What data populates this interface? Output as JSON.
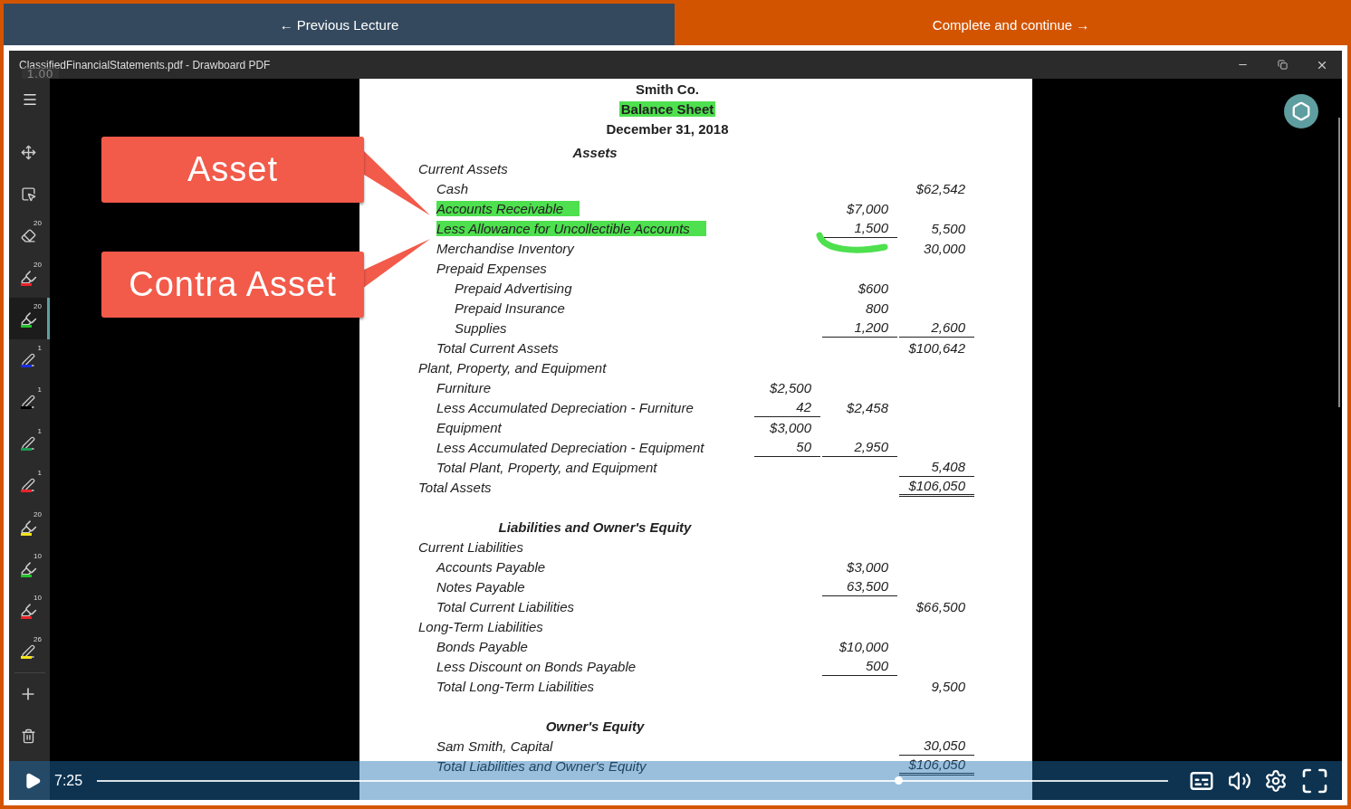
{
  "nav": {
    "previous": {
      "label": "Previous Lecture",
      "icon": "←"
    },
    "complete": {
      "label": "Complete and continue",
      "icon": "→"
    }
  },
  "window": {
    "title": "ClassifiedFinancialStatements.pdf - Drawboard PDF",
    "zoom_label": "1.00"
  },
  "tools": [
    {
      "kind": "move",
      "selected": false
    },
    {
      "kind": "select",
      "selected": false
    },
    {
      "kind": "eraser",
      "badge": "20",
      "selected": false
    },
    {
      "kind": "marker",
      "badge": "20",
      "color": "#e8232a",
      "selected": false
    },
    {
      "kind": "marker",
      "badge": "20",
      "color": "#22c02a",
      "selected": true
    },
    {
      "kind": "pen",
      "badge": "1",
      "color": "#1a2ee0",
      "selected": false
    },
    {
      "kind": "pen",
      "badge": "1",
      "color": "#000000",
      "selected": false
    },
    {
      "kind": "pen",
      "badge": "1",
      "color": "#1d9a55",
      "selected": false
    },
    {
      "kind": "pen",
      "badge": "1",
      "color": "#e8232a",
      "selected": false
    },
    {
      "kind": "marker",
      "badge": "20",
      "color": "#f2e21b",
      "selected": false
    },
    {
      "kind": "marker",
      "badge": "10",
      "color": "#22c02a",
      "selected": false
    },
    {
      "kind": "marker",
      "badge": "10",
      "color": "#e8232a",
      "selected": false
    },
    {
      "kind": "pen",
      "badge": "26",
      "color": "#f2e21b",
      "selected": false
    }
  ],
  "callouts": [
    {
      "text": "Asset"
    },
    {
      "text": "Contra Asset"
    }
  ],
  "document": {
    "titles": [
      {
        "text": "Smith Co.",
        "highlighted": false
      },
      {
        "text": "Balance Sheet",
        "highlighted": true
      },
      {
        "text": "December 31, 2018",
        "highlighted": false
      }
    ],
    "sections": [
      {
        "kind": "grouped",
        "heading": "Assets",
        "children": [
          {
            "text": "Current Assets",
            "highlighted": false,
            "children": [
              {
                "text": "Cash",
                "highlighted": false,
                "col_3": {
                  "text": "$62,542"
                }
              },
              {
                "text": "Accounts Receivable",
                "highlighted": true,
                "col_2": {
                  "text": "$7,000"
                }
              },
              {
                "text": "Less Allowance for Uncollectible Accounts",
                "highlighted": true,
                "col_2": {
                  "text": "1,500",
                  "underlined": true
                },
                "col_3": {
                  "text": "5,500"
                }
              },
              {
                "text": "Merchandise Inventory",
                "highlighted": false,
                "col_3": {
                  "text": "30,000"
                }
              },
              {
                "text": "Prepaid Expenses",
                "highlighted": false,
                "children": [
                  {
                    "text": "Prepaid Advertising",
                    "highlighted": false,
                    "col_2": {
                      "text": "$600"
                    }
                  },
                  {
                    "text": "Prepaid Insurance",
                    "highlighted": false,
                    "col_2": {
                      "text": "800"
                    }
                  },
                  {
                    "text": "Supplies",
                    "highlighted": false,
                    "col_2": {
                      "text": "1,200",
                      "underlined": true
                    },
                    "col_3": {
                      "text": "2,600",
                      "underlined": true
                    }
                  }
                ]
              },
              {
                "text": "Total Current Assets",
                "highlighted": false,
                "col_3": {
                  "text": "$100,642"
                }
              }
            ]
          },
          {
            "text": "Plant, Property, and Equipment",
            "highlighted": false,
            "children": [
              {
                "text": "Furniture",
                "highlighted": false,
                "col_1": {
                  "text": "$2,500"
                }
              },
              {
                "text": "Less Accumulated Depreciation - Furniture",
                "highlighted": false,
                "col_1": {
                  "text": "42",
                  "underlined": true
                },
                "col_2": {
                  "text": "$2,458"
                }
              },
              {
                "text": "Equipment",
                "highlighted": false,
                "col_1": {
                  "text": "$3,000"
                }
              },
              {
                "text": "Less Accumulated Depreciation - Equipment",
                "highlighted": false,
                "col_1": {
                  "text": "50",
                  "underlined": true
                },
                "col_2": {
                  "text": "2,950",
                  "underlined": true
                }
              },
              {
                "text": "Total Plant, Property, and Equipment",
                "highlighted": false,
                "col_3": {
                  "text": "5,408",
                  "underlined": true
                }
              }
            ]
          },
          {
            "text": "Total Assets",
            "highlighted": false,
            "col_3": {
              "text": "$106,050",
              "double_underlined": true
            }
          }
        ]
      },
      {
        "kind": "grouped",
        "heading": "Liabilities and Owner's Equity",
        "children": [
          {
            "text": "Current Liabilities",
            "highlighted": false,
            "children": [
              {
                "text": "Accounts Payable",
                "highlighted": false,
                "col_2": {
                  "text": "$3,000"
                }
              },
              {
                "text": "Notes Payable",
                "highlighted": false,
                "col_2": {
                  "text": "63,500",
                  "underlined": true
                }
              },
              {
                "text": "Total Current Liabilities",
                "highlighted": false,
                "col_3": {
                  "text": "$66,500"
                }
              }
            ]
          },
          {
            "text": "Long-Term Liabilities",
            "highlighted": false,
            "children": [
              {
                "text": "Bonds Payable",
                "highlighted": false,
                "col_2": {
                  "text": "$10,000"
                }
              },
              {
                "text": "Less Discount on Bonds Payable",
                "highlighted": false,
                "col_2": {
                  "text": "500",
                  "underlined": true
                }
              },
              {
                "text": "Total Long-Term Liabilities",
                "highlighted": false,
                "col_3": {
                  "text": "9,500"
                }
              }
            ]
          }
        ]
      },
      {
        "kind": "flat",
        "heading": "Owner's Equity",
        "children": [
          {
            "text": "Sam Smith, Capital",
            "highlighted": false,
            "col_3": {
              "text": "30,050",
              "underlined": true
            }
          },
          {
            "text": "Total Liabilities and Owner's Equity",
            "highlighted": false,
            "col_3": {
              "text": "$106,050",
              "double_underlined": true
            }
          }
        ]
      }
    ]
  },
  "player": {
    "time": "7:25",
    "level": 0.748
  }
}
